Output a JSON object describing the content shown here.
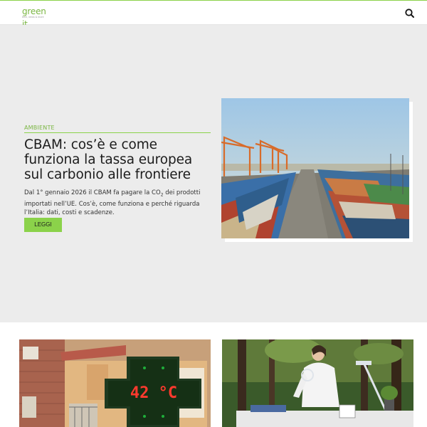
{
  "header": {
    "logo_text": "green it",
    "logo_tagline": "tech, news & more",
    "search_icon": "search-icon"
  },
  "hero": {
    "category": "AMBIENTE",
    "title": "CBAM: cos’è e come funziona la tassa europea sul carbonio alle frontiere",
    "excerpt_before": "Dal 1° gennaio 2026 il CBAM fa pagare la CO",
    "excerpt_sub": "2",
    "excerpt_after": " dei prodotti importati nell’UE. Cos’è, come funziona e perché riguarda l’Italia: dati, costi e scadenze.",
    "button_label": "LEGGI",
    "image": "container-port-photo"
  },
  "cards": [
    {
      "image": "pharmacy-sign-temperature-photo",
      "sign_text": "42 °C"
    },
    {
      "image": "scientist-in-forest-lab-photo"
    }
  ],
  "colors": {
    "accent": "#8bd24a",
    "hero_background": "#ececec",
    "category_text": "#7ab642"
  }
}
